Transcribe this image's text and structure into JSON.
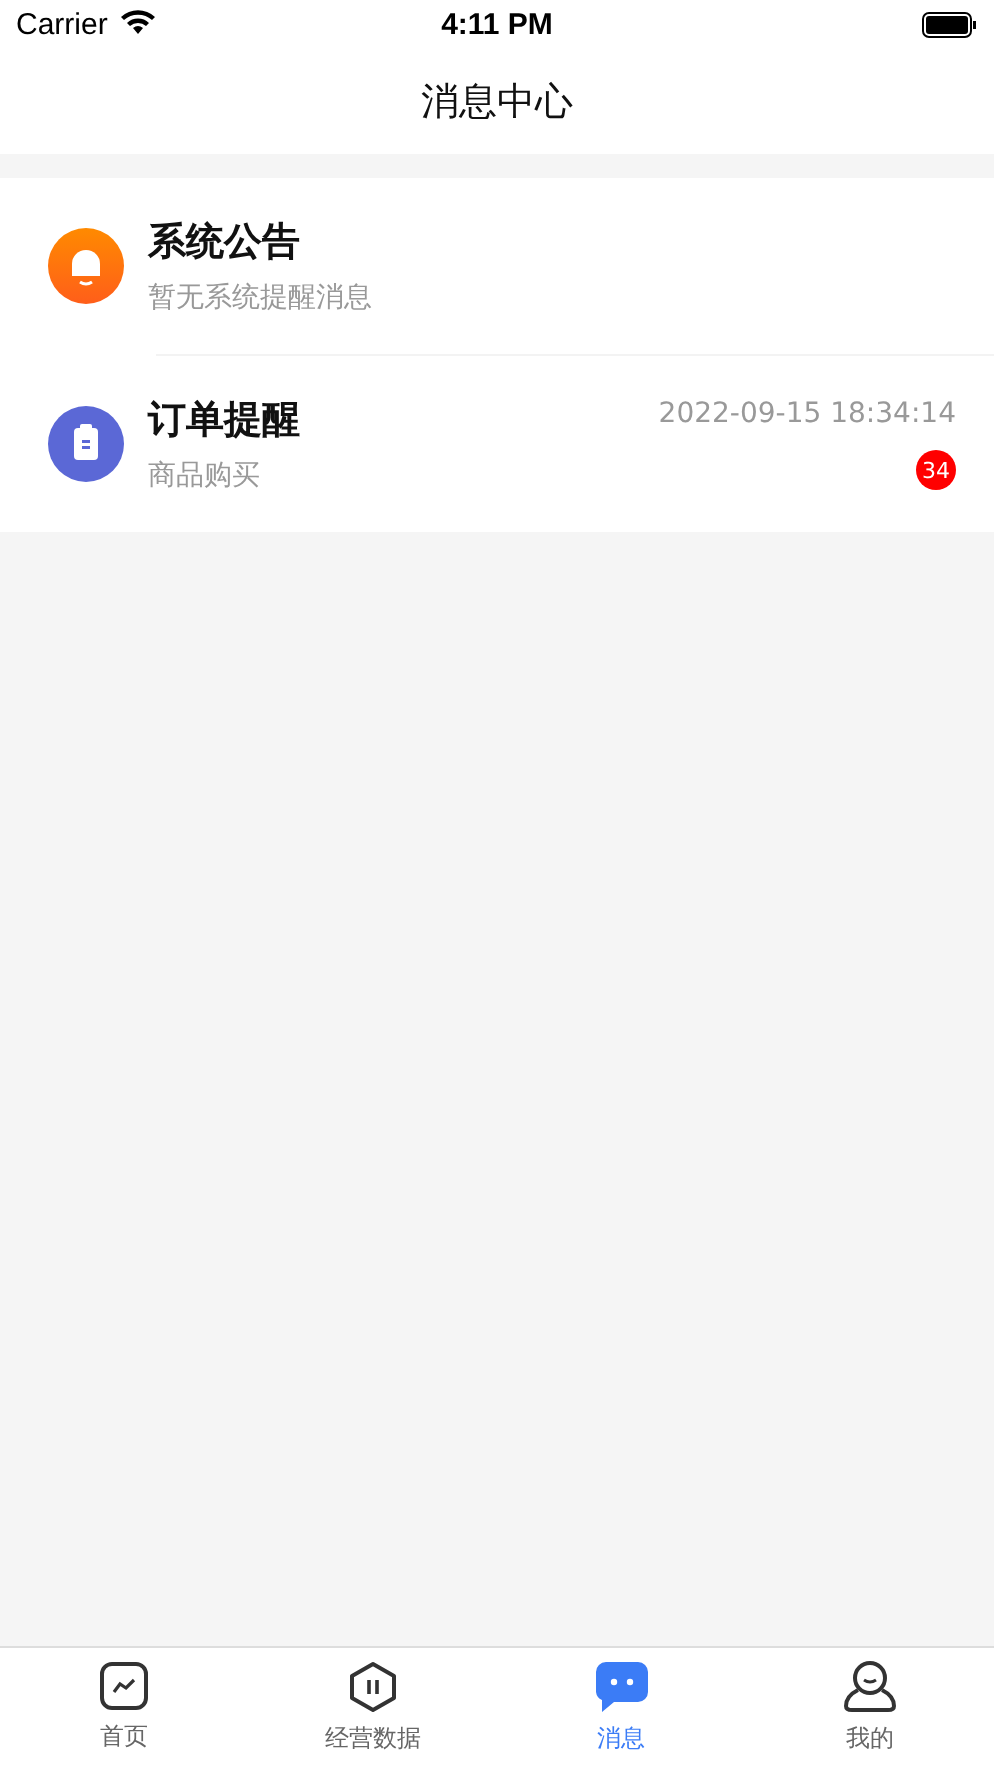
{
  "status_bar": {
    "carrier": "Carrier",
    "time": "4:11 PM"
  },
  "title": "消息中心",
  "messages": [
    {
      "kind": "bell",
      "title": "系统公告",
      "subtitle": "暂无系统提醒消息"
    },
    {
      "kind": "clipboard",
      "title": "订单提醒",
      "subtitle": "商品购买",
      "time": "2022-09-15 18:34:14",
      "badge": "34"
    }
  ],
  "tabs": [
    {
      "kind": "chart",
      "label": "首页",
      "selected": false
    },
    {
      "kind": "hexagon",
      "label": "经营数据",
      "selected": false
    },
    {
      "kind": "chat",
      "label": "消息",
      "selected": true
    },
    {
      "kind": "person",
      "label": "我的",
      "selected": false
    }
  ]
}
